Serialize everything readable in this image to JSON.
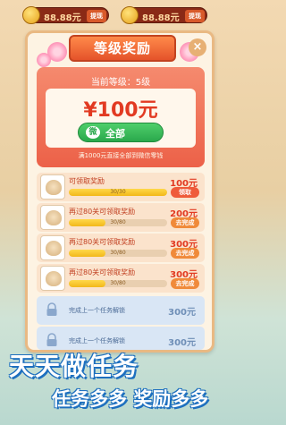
{
  "topbar": {
    "left": {
      "amount": "88.88元",
      "button": "提现"
    },
    "right": {
      "amount": "88.88元",
      "button": "提现"
    }
  },
  "modal": {
    "title": "等级奖励",
    "close_glyph": "×",
    "level_label": "当前等级：5级",
    "amount": "¥100元",
    "withdraw_label": "全部",
    "wechat_glyph": "微",
    "note": "满1000元直接全部到微信零钱"
  },
  "tasks": [
    {
      "name": "可领取奖励",
      "progress_text": "30/30",
      "progress": 1.0,
      "reward": "100元",
      "button": "领取",
      "state": "claim"
    },
    {
      "name": "再过80关可领取奖励",
      "progress_text": "30/80",
      "progress": 0.375,
      "reward": "200元",
      "button": "去完成",
      "state": "goto"
    },
    {
      "name": "再过80关可领取奖励",
      "progress_text": "30/80",
      "progress": 0.375,
      "reward": "300元",
      "button": "去完成",
      "state": "goto"
    },
    {
      "name": "再过80关可领取奖励",
      "progress_text": "30/80",
      "progress": 0.375,
      "reward": "300元",
      "button": "去完成",
      "state": "goto"
    }
  ],
  "locked_tasks": [
    {
      "label": "完成上一个任务解锁",
      "reward": "300元"
    },
    {
      "label": "完成上一个任务解锁",
      "reward": "300元"
    }
  ],
  "promo": {
    "line1": "天天做任务",
    "line2": "任务多多 奖励多多"
  },
  "colors": {
    "primary_red": "#e23a22",
    "green_button": "#2aa84c",
    "promo_outline": "#1d6fbf"
  }
}
